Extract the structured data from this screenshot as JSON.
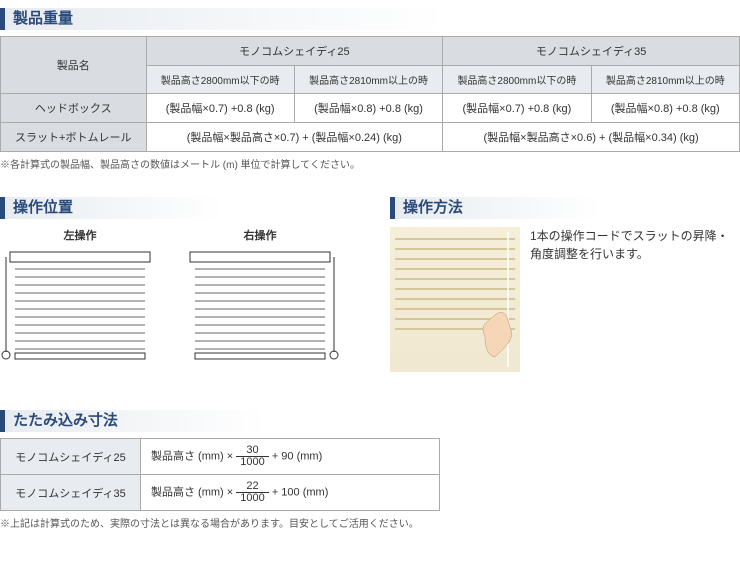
{
  "sections": {
    "weight": "製品重量",
    "position": "操作位置",
    "method": "操作方法",
    "fold": "たたみ込み寸法"
  },
  "weight_table": {
    "header_product": "製品名",
    "group1": "モノコムシェイディ25",
    "group2": "モノコムシェイディ35",
    "sub1": "製品高さ2800mm以下の時",
    "sub2": "製品高さ2810mm以上の時",
    "sub3": "製品高さ2800mm以下の時",
    "sub4": "製品高さ2810mm以上の時",
    "row1_label": "ヘッドボックス",
    "row1_c1": "(製品幅×0.7) +0.8 (kg)",
    "row1_c2": "(製品幅×0.8) +0.8 (kg)",
    "row1_c3": "(製品幅×0.7) +0.8 (kg)",
    "row1_c4": "(製品幅×0.8) +0.8 (kg)",
    "row2_label": "スラット+ボトムレール",
    "row2_c1": "(製品幅×製品高さ×0.7) + (製品幅×0.24) (kg)",
    "row2_c2": "(製品幅×製品高さ×0.6) + (製品幅×0.34) (kg)"
  },
  "weight_note": "※各計算式の製品幅、製品高さの数値はメートル (m) 単位で計算してください。",
  "position": {
    "left_label": "左操作",
    "right_label": "右操作"
  },
  "method_text": "1本の操作コードでスラットの昇降・角度調整を行います。",
  "fold_table": {
    "row1_label": "モノコムシェイディ25",
    "row1_prefix": "製品高さ (mm) ×",
    "row1_num": "30",
    "row1_den": "1000",
    "row1_suffix": "+ 90 (mm)",
    "row2_label": "モノコムシェイディ35",
    "row2_prefix": "製品高さ (mm) ×",
    "row2_num": "22",
    "row2_den": "1000",
    "row2_suffix": "+ 100 (mm)"
  },
  "fold_note": "※上記は計算式のため、実際の寸法とは異なる場合があります。目安としてご活用ください。"
}
